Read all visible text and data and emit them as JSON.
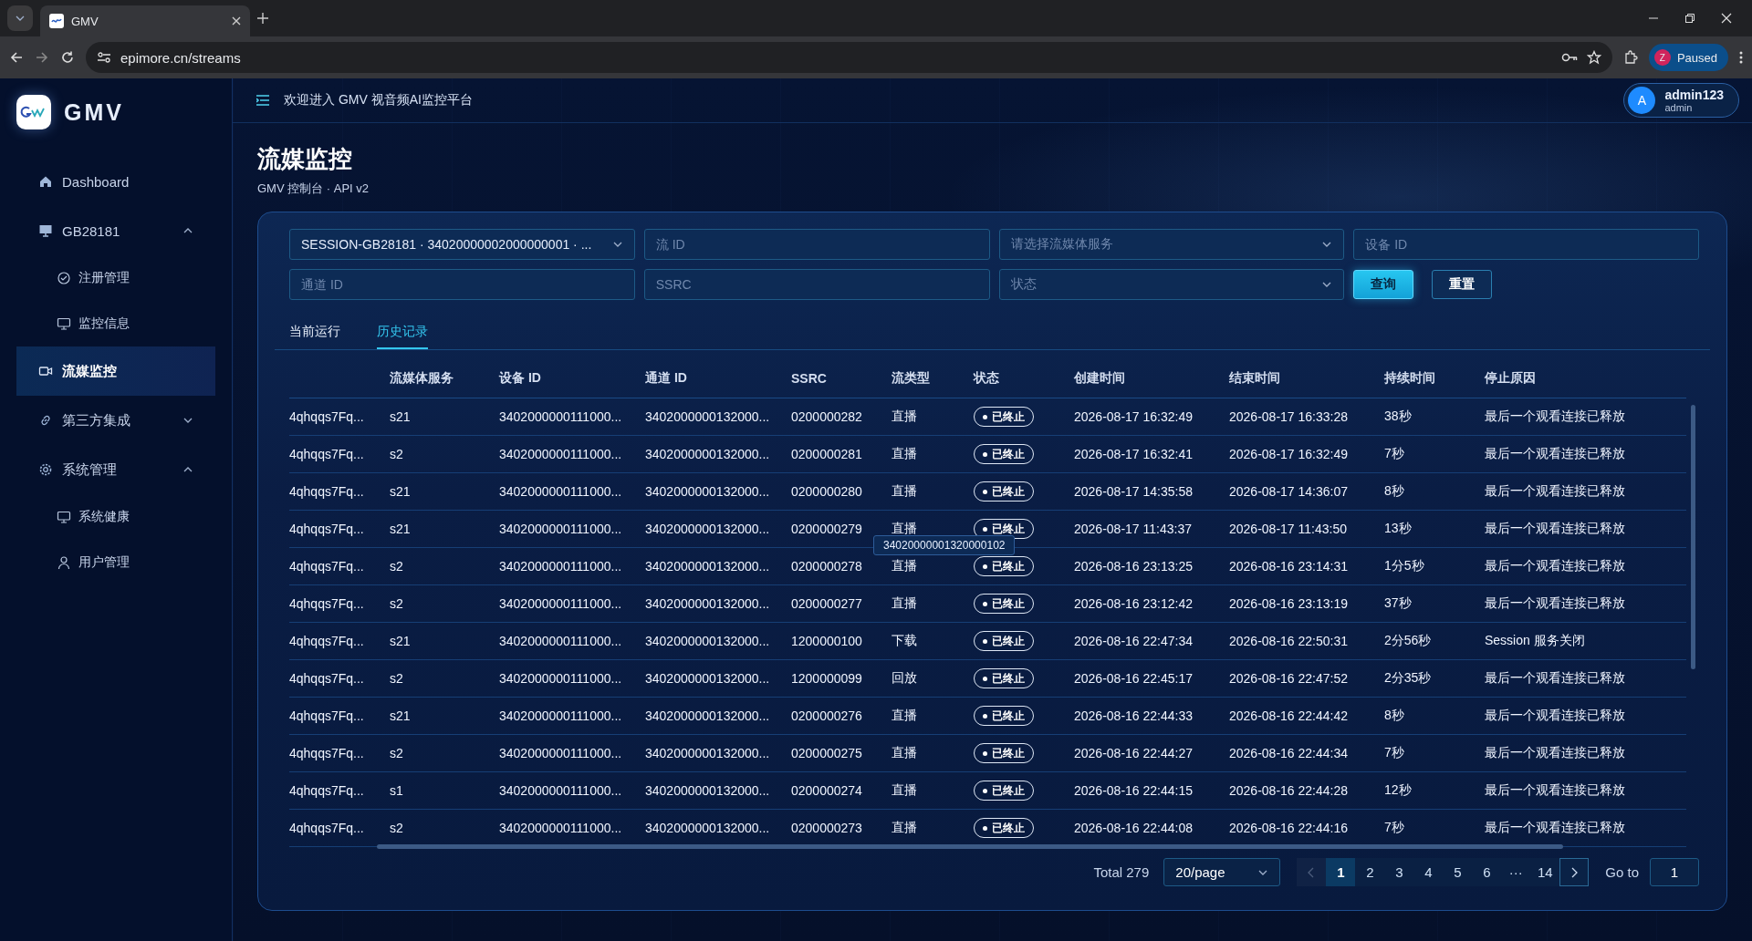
{
  "browser": {
    "tab_title": "GMV",
    "url": "epimore.cn/streams",
    "profile_initial": "Z",
    "profile_label": "Paused"
  },
  "sidebar": {
    "logo": "GMV",
    "items": [
      {
        "label": "Dashboard",
        "selected": false
      },
      {
        "label": "GB28181",
        "selected": false,
        "expanded": true,
        "children": [
          {
            "label": "注册管理",
            "selected": false
          },
          {
            "label": "监控信息",
            "selected": false
          }
        ]
      },
      {
        "label": "流媒监控",
        "selected": true
      },
      {
        "label": "第三方集成",
        "selected": false,
        "expanded": false
      },
      {
        "label": "系统管理",
        "selected": false,
        "expanded": true,
        "children": [
          {
            "label": "系统健康",
            "selected": false
          },
          {
            "label": "用户管理",
            "selected": false
          }
        ]
      }
    ]
  },
  "header": {
    "welcome": "欢迎进入 GMV 视音频AI监控平台",
    "avatar_initial": "A",
    "user_name": "admin123",
    "user_role": "admin"
  },
  "page": {
    "title": "流媒监控",
    "subtitle": "GMV 控制台 · API v2"
  },
  "filters": [
    {
      "kind": "select",
      "value": "SESSION-GB28181 · 34020000002000000001 · ..."
    },
    {
      "kind": "input",
      "placeholder": "流 ID"
    },
    {
      "kind": "select",
      "placeholder": "请选择流媒体服务"
    },
    {
      "kind": "input",
      "placeholder": "设备 ID"
    },
    {
      "kind": "input",
      "placeholder": "通道 ID"
    },
    {
      "kind": "input",
      "placeholder": "SSRC"
    },
    {
      "kind": "select",
      "placeholder": "状态"
    }
  ],
  "buttons": [
    {
      "kind": "primary",
      "label": "查询"
    },
    {
      "kind": "secondary",
      "label": "重置"
    }
  ],
  "tabs": [
    {
      "label": "当前运行",
      "selected": false
    },
    {
      "label": "历史记录",
      "selected": true
    }
  ],
  "table": {
    "columns": [
      "流媒体服务",
      "设备 ID",
      "通道 ID",
      "SSRC",
      "流类型",
      "状态",
      "创建时间",
      "结束时间",
      "持续时间",
      "停止原因"
    ],
    "rows": [
      {
        "column_1": "4qhqqs7Fq...",
        "service": "s21",
        "device_id": "3402000000111000...",
        "channel_id": "3402000000132000...",
        "ssrc": "0200000282",
        "stream_type": "直播",
        "status": "已终止",
        "created": "2026-08-17 16:32:49",
        "ended": "2026-08-17 16:33:28",
        "duration": "38秒",
        "stop_reason": "最后一个观看连接已释放"
      },
      {
        "column_1": "4qhqqs7Fq...",
        "service": "s2",
        "device_id": "3402000000111000...",
        "channel_id": "3402000000132000...",
        "ssrc": "0200000281",
        "stream_type": "直播",
        "status": "已终止",
        "created": "2026-08-17 16:32:41",
        "ended": "2026-08-17 16:32:49",
        "duration": "7秒",
        "stop_reason": "最后一个观看连接已释放"
      },
      {
        "column_1": "4qhqqs7Fq...",
        "service": "s21",
        "device_id": "3402000000111000...",
        "channel_id": "3402000000132000...",
        "ssrc": "0200000280",
        "stream_type": "直播",
        "status": "已终止",
        "created": "2026-08-17 14:35:58",
        "ended": "2026-08-17 14:36:07",
        "duration": "8秒",
        "stop_reason": "最后一个观看连接已释放"
      },
      {
        "column_1": "4qhqqs7Fq...",
        "service": "s21",
        "device_id": "3402000000111000...",
        "channel_id": "3402000000132000...",
        "ssrc": "0200000279",
        "stream_type": "直播",
        "status": "已终止",
        "created": "2026-08-17 11:43:37",
        "ended": "2026-08-17 11:43:50",
        "duration": "13秒",
        "stop_reason": "最后一个观看连接已释放"
      },
      {
        "column_1": "4qhqqs7Fq...",
        "service": "s2",
        "device_id": "3402000000111000...",
        "channel_id": "3402000000132000...",
        "ssrc": "0200000278",
        "stream_type": "直播",
        "status": "已终止",
        "created": "2026-08-16 23:13:25",
        "ended": "2026-08-16 23:14:31",
        "duration": "1分5秒",
        "stop_reason": "最后一个观看连接已释放"
      },
      {
        "column_1": "4qhqqs7Fq...",
        "service": "s2",
        "device_id": "3402000000111000...",
        "channel_id": "3402000000132000...",
        "ssrc": "0200000277",
        "stream_type": "直播",
        "status": "已终止",
        "created": "2026-08-16 23:12:42",
        "ended": "2026-08-16 23:13:19",
        "duration": "37秒",
        "stop_reason": "最后一个观看连接已释放"
      },
      {
        "column_1": "4qhqqs7Fq...",
        "service": "s21",
        "device_id": "3402000000111000...",
        "channel_id": "3402000000132000...",
        "ssrc": "1200000100",
        "stream_type": "下载",
        "status": "已终止",
        "created": "2026-08-16 22:47:34",
        "ended": "2026-08-16 22:50:31",
        "duration": "2分56秒",
        "stop_reason": "Session 服务关闭"
      },
      {
        "column_1": "4qhqqs7Fq...",
        "service": "s2",
        "device_id": "3402000000111000...",
        "channel_id": "3402000000132000...",
        "ssrc": "1200000099",
        "stream_type": "回放",
        "status": "已终止",
        "created": "2026-08-16 22:45:17",
        "ended": "2026-08-16 22:47:52",
        "duration": "2分35秒",
        "stop_reason": "最后一个观看连接已释放"
      },
      {
        "column_1": "4qhqqs7Fq...",
        "service": "s21",
        "device_id": "3402000000111000...",
        "channel_id": "3402000000132000...",
        "ssrc": "0200000276",
        "stream_type": "直播",
        "status": "已终止",
        "created": "2026-08-16 22:44:33",
        "ended": "2026-08-16 22:44:42",
        "duration": "8秒",
        "stop_reason": "最后一个观看连接已释放"
      },
      {
        "column_1": "4qhqqs7Fq...",
        "service": "s2",
        "device_id": "3402000000111000...",
        "channel_id": "3402000000132000...",
        "ssrc": "0200000275",
        "stream_type": "直播",
        "status": "已终止",
        "created": "2026-08-16 22:44:27",
        "ended": "2026-08-16 22:44:34",
        "duration": "7秒",
        "stop_reason": "最后一个观看连接已释放"
      },
      {
        "column_1": "4qhqqs7Fq...",
        "service": "s1",
        "device_id": "3402000000111000...",
        "channel_id": "3402000000132000...",
        "ssrc": "0200000274",
        "stream_type": "直播",
        "status": "已终止",
        "created": "2026-08-16 22:44:15",
        "ended": "2026-08-16 22:44:28",
        "duration": "12秒",
        "stop_reason": "最后一个观看连接已释放"
      },
      {
        "column_1": "4qhqqs7Fq...",
        "service": "s2",
        "device_id": "3402000000111000...",
        "channel_id": "3402000000132000...",
        "ssrc": "0200000273",
        "stream_type": "直播",
        "status": "已终止",
        "created": "2026-08-16 22:44:08",
        "ended": "2026-08-16 22:44:16",
        "duration": "7秒",
        "stop_reason": "最后一个观看连接已释放"
      }
    ]
  },
  "tooltip": {
    "text": "34020000001320000102"
  },
  "pagination": {
    "total": "Total 279",
    "page_size": "20/page",
    "prev": {
      "disabled": true
    },
    "next": {
      "disabled": false
    },
    "pages": [
      {
        "label": "1",
        "selected": true
      },
      {
        "label": "2",
        "selected": false
      },
      {
        "label": "3",
        "selected": false
      },
      {
        "label": "4",
        "selected": false
      },
      {
        "label": "5",
        "selected": false
      },
      {
        "label": "6",
        "selected": false
      },
      {
        "label": "···",
        "selected": false
      },
      {
        "label": "14",
        "selected": false
      }
    ],
    "goto_label": "Go to",
    "goto_value": "1"
  }
}
